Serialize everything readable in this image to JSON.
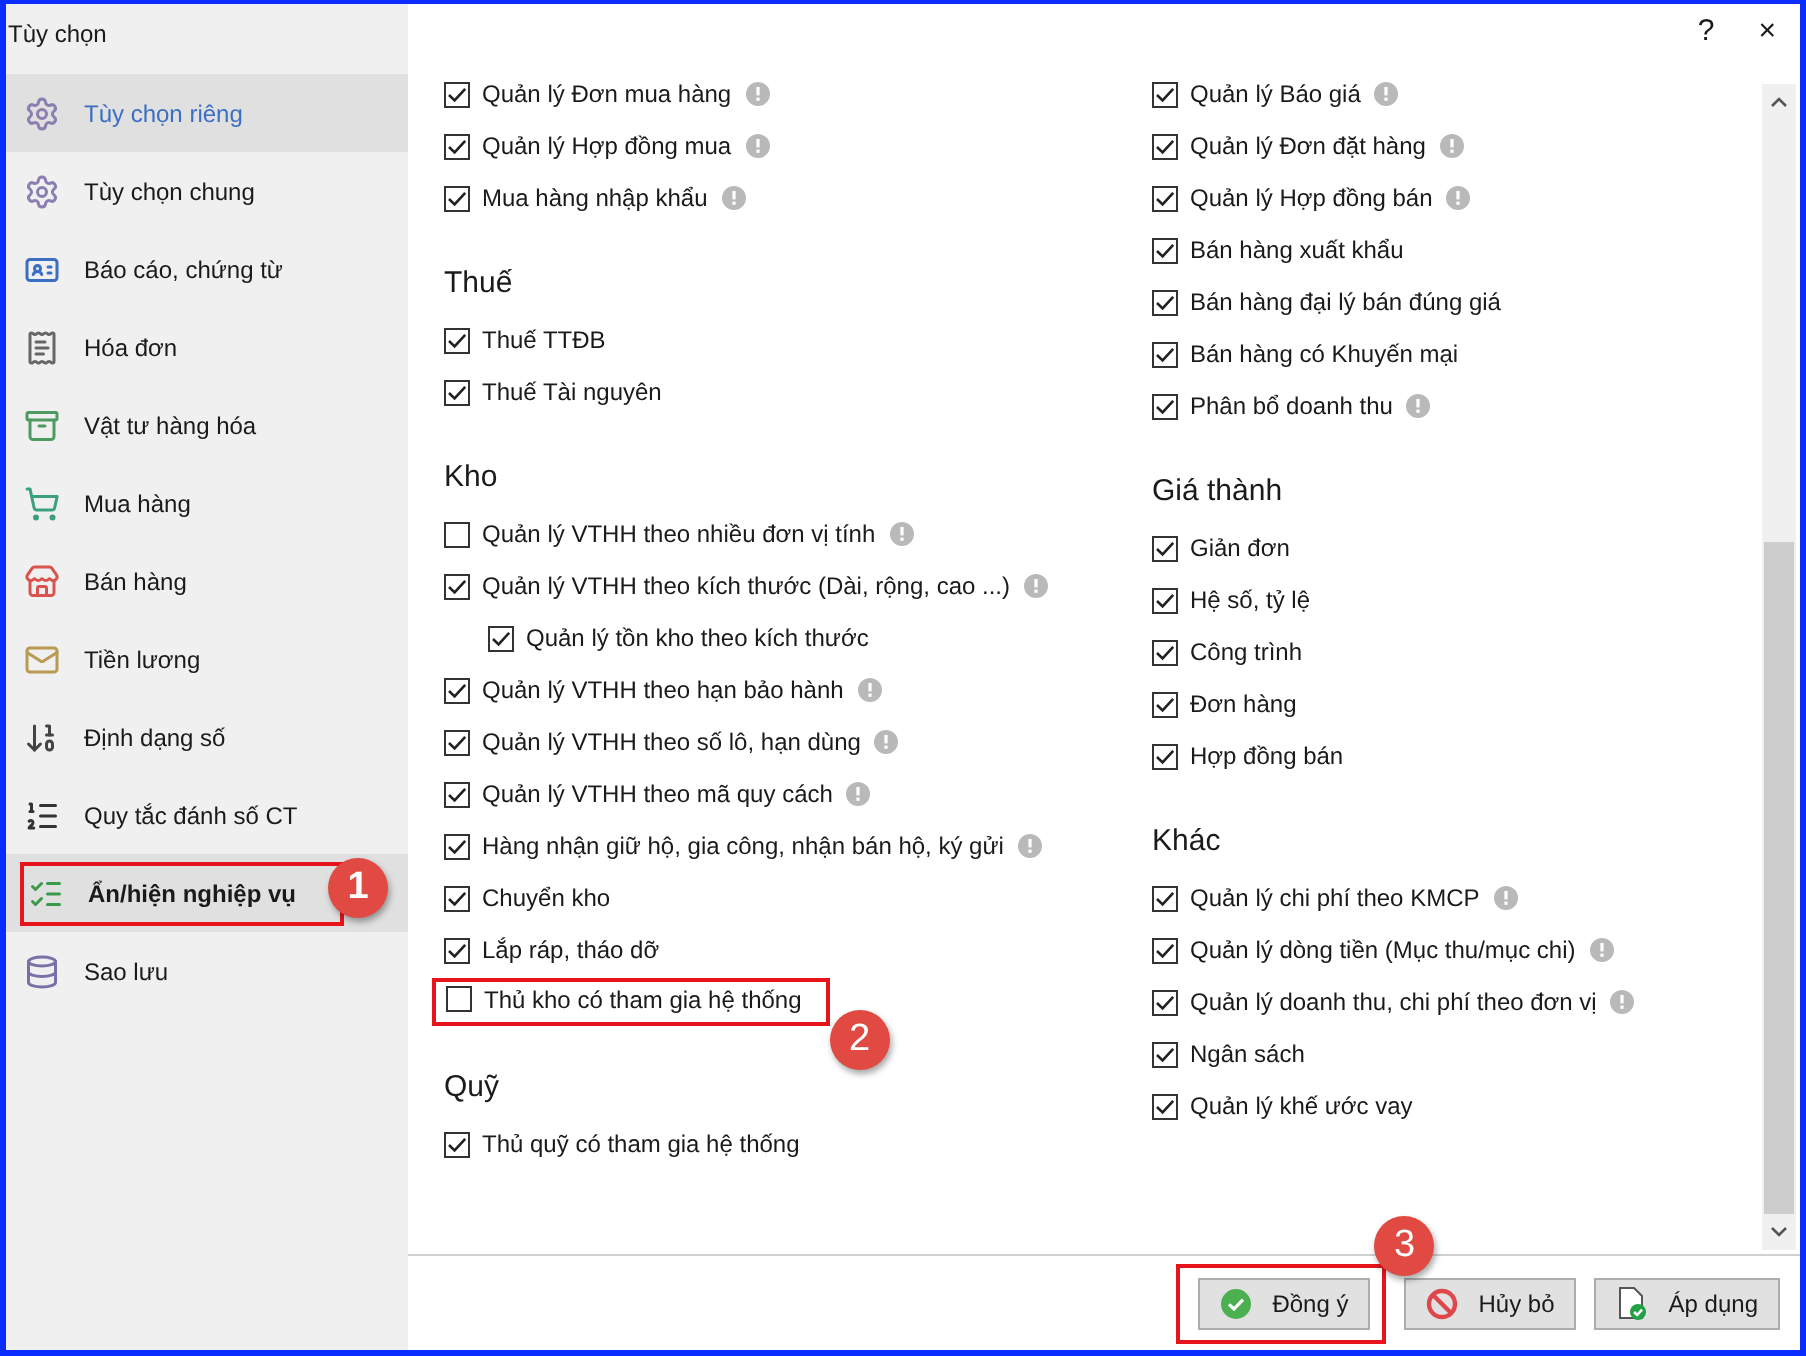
{
  "window": {
    "title": "Tùy chọn",
    "help": "?",
    "close": "×"
  },
  "sidebar": {
    "items": [
      {
        "label": "Tùy chọn riêng",
        "selected": false,
        "hovered": true
      },
      {
        "label": "Tùy chọn chung",
        "selected": false,
        "hovered": false
      },
      {
        "label": "Báo cáo, chứng từ",
        "selected": false,
        "hovered": false
      },
      {
        "label": "Hóa đơn",
        "selected": false,
        "hovered": false
      },
      {
        "label": "Vật tư hàng hóa",
        "selected": false,
        "hovered": false
      },
      {
        "label": "Mua hàng",
        "selected": false,
        "hovered": false
      },
      {
        "label": "Bán hàng",
        "selected": false,
        "hovered": false
      },
      {
        "label": "Tiền lương",
        "selected": false,
        "hovered": false
      },
      {
        "label": "Định dạng số",
        "selected": false,
        "hovered": false
      },
      {
        "label": "Quy tắc đánh số CT",
        "selected": false,
        "hovered": false
      },
      {
        "label": "Ẩn/hiện nghiệp vụ",
        "selected": true,
        "hovered": false,
        "callout": "1"
      },
      {
        "label": "Sao lưu",
        "selected": false,
        "hovered": false
      }
    ]
  },
  "columns": [
    {
      "sections": [
        {
          "items": [
            {
              "label": "Quản lý Đơn mua hàng",
              "checked": true,
              "info": true
            },
            {
              "label": "Quản lý Hợp đồng mua",
              "checked": true,
              "info": true
            },
            {
              "label": "Mua hàng nhập khẩu",
              "checked": true,
              "info": true
            }
          ]
        },
        {
          "heading": "Thuế",
          "items": [
            {
              "label": "Thuế TTĐB",
              "checked": true,
              "info": false
            },
            {
              "label": "Thuế Tài nguyên",
              "checked": true,
              "info": false
            }
          ]
        },
        {
          "heading": "Kho",
          "items": [
            {
              "label": "Quản lý VTHH theo nhiều đơn vị tính",
              "checked": false,
              "info": true
            },
            {
              "label": "Quản lý VTHH theo kích thước (Dài, rộng, cao ...)",
              "checked": true,
              "info": true,
              "children": [
                {
                  "label": "Quản lý tồn kho theo kích thước",
                  "checked": true,
                  "info": false
                }
              ]
            },
            {
              "label": "Quản lý VTHH theo hạn bảo hành",
              "checked": true,
              "info": true
            },
            {
              "label": "Quản lý VTHH theo số lô, hạn dùng",
              "checked": true,
              "info": true
            },
            {
              "label": "Quản lý VTHH theo mã quy cách",
              "checked": true,
              "info": true
            },
            {
              "label": "Hàng nhận giữ hộ, gia công, nhận bán hộ, ký gửi",
              "checked": true,
              "info": true
            },
            {
              "label": "Chuyển kho",
              "checked": true,
              "info": false
            },
            {
              "label": "Lắp ráp, tháo dỡ",
              "checked": true,
              "info": false
            },
            {
              "label": "Thủ kho có tham gia hệ thống",
              "checked": false,
              "info": false,
              "callout": "2"
            }
          ]
        },
        {
          "heading": "Quỹ",
          "items": [
            {
              "label": "Thủ quỹ có tham gia hệ thống",
              "checked": true,
              "info": false
            }
          ]
        }
      ]
    },
    {
      "sections": [
        {
          "items": [
            {
              "label": "Quản lý Báo giá",
              "checked": true,
              "info": true
            },
            {
              "label": "Quản lý Đơn đặt hàng",
              "checked": true,
              "info": true
            },
            {
              "label": "Quản lý Hợp đồng bán",
              "checked": true,
              "info": true
            },
            {
              "label": "Bán hàng xuất khẩu",
              "checked": true,
              "info": false
            },
            {
              "label": "Bán hàng đại lý bán đúng giá",
              "checked": true,
              "info": false
            },
            {
              "label": "Bán hàng có Khuyến mại",
              "checked": true,
              "info": false
            },
            {
              "label": "Phân bổ doanh thu",
              "checked": true,
              "info": true
            }
          ]
        },
        {
          "heading": "Giá thành",
          "items": [
            {
              "label": "Giản đơn",
              "checked": true,
              "info": false
            },
            {
              "label": "Hệ số, tỷ lệ",
              "checked": true,
              "info": false
            },
            {
              "label": "Công trình",
              "checked": true,
              "info": false
            },
            {
              "label": "Đơn hàng",
              "checked": true,
              "info": false
            },
            {
              "label": "Hợp đồng bán",
              "checked": true,
              "info": false
            }
          ]
        },
        {
          "heading": "Khác",
          "items": [
            {
              "label": "Quản lý chi phí theo KMCP",
              "checked": true,
              "info": true
            },
            {
              "label": "Quản lý dòng tiền (Mục thu/mục chi)",
              "checked": true,
              "info": true
            },
            {
              "label": "Quản lý doanh thu, chi phí theo đơn vị",
              "checked": true,
              "info": true
            },
            {
              "label": "Ngân sách",
              "checked": true,
              "info": false
            },
            {
              "label": "Quản lý khế ước vay",
              "checked": true,
              "info": false
            }
          ]
        }
      ]
    }
  ],
  "buttons": [
    {
      "label": "Đồng ý",
      "kind": "ok",
      "callout": "3"
    },
    {
      "label": "Hủy bỏ",
      "kind": "cancel"
    },
    {
      "label": "Áp dụng",
      "kind": "apply"
    }
  ]
}
